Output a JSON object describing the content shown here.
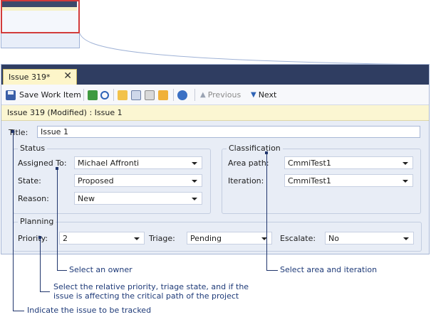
{
  "tab": {
    "title": "Issue 319*",
    "close": "✕"
  },
  "toolbar": {
    "save_label": "Save Work Item",
    "previous_label": "Previous",
    "next_label": "Next"
  },
  "status": {
    "text": "Issue 319 (Modified) : Issue 1"
  },
  "form": {
    "title_label": "Title:",
    "title_value": "Issue 1",
    "status_group": "Status",
    "assigned_label": "Assigned To:",
    "assigned_value": "Michael Affronti",
    "state_label": "State:",
    "state_value": "Proposed",
    "reason_label": "Reason:",
    "reason_value": "New",
    "classification_group": "Classification",
    "area_label": "Area path:",
    "area_value": "CmmiTest1",
    "iteration_label": "Iteration:",
    "iteration_value": "CmmiTest1",
    "planning_group": "Planning",
    "priority_label": "Priority:",
    "priority_value": "2",
    "triage_label": "Triage:",
    "triage_value": "Pending",
    "escalate_label": "Escalate:",
    "escalate_value": "No"
  },
  "annotations": {
    "owner": "Select an owner",
    "area": "Select area and iteration",
    "priority_line1": "Select the relative priority, triage state, and if the",
    "priority_line2": "issue is affecting the critical path of the project",
    "title": "Indicate the issue to be tracked"
  },
  "colors": {
    "tab_strip": "#2f3d61",
    "active_tab": "#fdf5c9",
    "status_bar": "#fbf6d2",
    "annotation_line": "#20356c",
    "thumbnail_highlight": "#d23b3b"
  }
}
